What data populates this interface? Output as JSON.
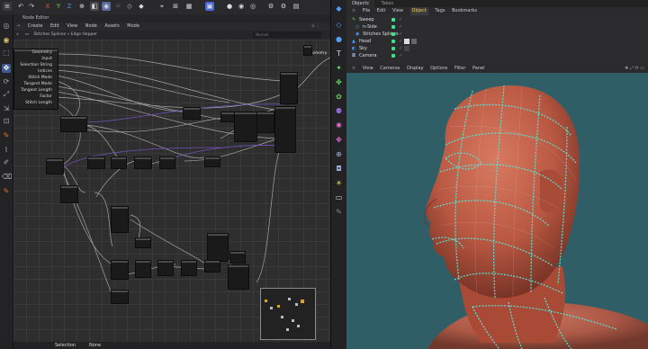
{
  "toolbar": {
    "axes": [
      "X",
      "Y",
      "Z"
    ]
  },
  "node_editor": {
    "title": "Node Editor",
    "menu": [
      "Create",
      "Edit",
      "View",
      "Node",
      "Assets",
      "Mode"
    ],
    "breadcrumb": [
      "Stitches Splines",
      "Edge Hopper"
    ],
    "search_placeholder": "Normal",
    "group_inputs": [
      "Geometry",
      "Input",
      "Selection String",
      "Indices",
      "Stitch Mode",
      "Tangent Mode",
      "Tangent Length",
      "Factor",
      "Stitch Length"
    ],
    "group_output": "Geometry",
    "status_label": "Selection",
    "status_value": "None"
  },
  "objects_panel": {
    "tabs": [
      "Objects",
      "Takes"
    ],
    "menu": [
      "File",
      "Edit",
      "View",
      "Object",
      "Tags",
      "Bookmarks"
    ],
    "active_menu": "Object",
    "items": [
      {
        "name": "Sweep",
        "indent": 0,
        "color": "#3fe08a"
      },
      {
        "name": "n-Side",
        "indent": 1,
        "color": "#3fe08a"
      },
      {
        "name": "Stitches Splines",
        "indent": 1,
        "color": "#3fe08a"
      },
      {
        "name": "Head",
        "indent": 0,
        "color": "#3fe08a"
      },
      {
        "name": "Sky",
        "indent": 0,
        "color": "#3fe08a"
      },
      {
        "name": "Camera",
        "indent": 0,
        "color": "#3fe08a"
      }
    ]
  },
  "viewport": {
    "menu": [
      "View",
      "Cameras",
      "Display",
      "Options",
      "Filter",
      "Panel"
    ],
    "background": "#2f5e66",
    "head_color": "#c0604a",
    "wire_color": "#5ce0d0"
  }
}
